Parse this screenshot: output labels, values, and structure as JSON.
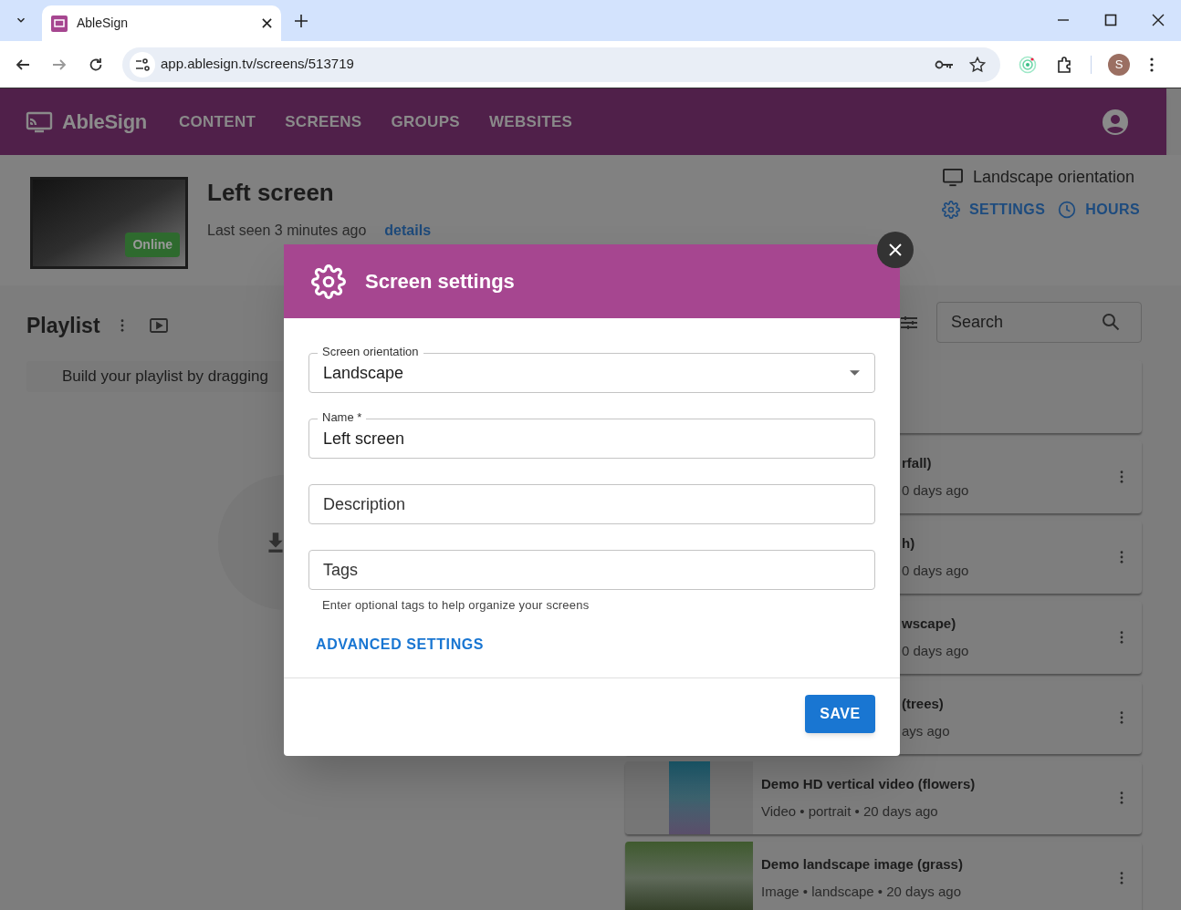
{
  "browser": {
    "tab_title": "AbleSign",
    "url": "app.ablesign.tv/screens/513719",
    "profile_initial": "S"
  },
  "header": {
    "brand": "AbleSign",
    "nav": [
      "CONTENT",
      "SCREENS",
      "GROUPS",
      "WEBSITES"
    ]
  },
  "screen": {
    "name": "Left screen",
    "last_seen": "Last seen 3 minutes ago",
    "details_link": "details",
    "status": "Online",
    "orientation": "Landscape orientation",
    "actions": [
      {
        "kind": "settings",
        "label": "SETTINGS"
      },
      {
        "kind": "hours",
        "label": "HOURS"
      }
    ]
  },
  "playlist": {
    "title": "Playlist",
    "hint": "Build your playlist by dragging"
  },
  "library": {
    "search": {
      "placeholder": "Search"
    },
    "items": [
      {
        "kind": "blank"
      },
      {
        "kind": "partial",
        "title": "rfall)",
        "subtitle": "0 days ago"
      },
      {
        "kind": "partial",
        "title": "h)",
        "subtitle": "0 days ago"
      },
      {
        "kind": "partial",
        "title": "wscape)",
        "subtitle": "0 days ago"
      },
      {
        "kind": "partial",
        "title": "(trees)",
        "subtitle": "ays ago"
      },
      {
        "kind": "portrait",
        "title": "Demo HD vertical video (flowers)",
        "subtitle": "Video • portrait • 20 days ago"
      },
      {
        "kind": "landscape",
        "title": "Demo landscape image (grass)",
        "subtitle": "Image • landscape • 20 days ago"
      }
    ]
  },
  "dialog": {
    "title": "Screen settings",
    "fields": [
      {
        "kind": "select",
        "label": "Screen orientation",
        "value": "Landscape"
      },
      {
        "kind": "text",
        "label": "Name *",
        "value": "Left screen"
      },
      {
        "kind": "text",
        "placeholder": "Description"
      },
      {
        "kind": "text",
        "placeholder": "Tags",
        "helper": "Enter optional tags to help organize your screens"
      }
    ],
    "advanced_link": "ADVANCED SETTINGS",
    "save_button": "SAVE"
  }
}
